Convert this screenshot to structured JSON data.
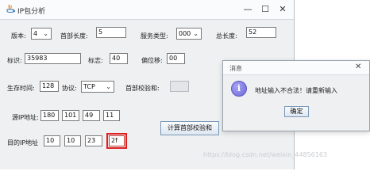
{
  "window": {
    "title": "IP包分析",
    "minimize_glyph": "—",
    "maximize_glyph": "☐",
    "close_glyph": "✕",
    "icon": "java-app-icon"
  },
  "form": {
    "version": {
      "label": "版本:",
      "value": "4"
    },
    "header_length": {
      "label": "首部长度:",
      "value": "5"
    },
    "service_type": {
      "label": "服务类型:",
      "value": "000"
    },
    "total_length": {
      "label": "总长度:",
      "value": "52"
    },
    "identification": {
      "label": "标识:",
      "value": "35983"
    },
    "flags": {
      "label": "标志:",
      "value": "40"
    },
    "fragment_offset": {
      "label": "偏位移:",
      "value": "00"
    },
    "ttl": {
      "label": "生存时间:",
      "value": "128"
    },
    "protocol": {
      "label": "协议:",
      "value": "TCP"
    },
    "header_checksum": {
      "label": "首部校验和:",
      "value": ""
    },
    "source_ip": {
      "label": "源IP地址:",
      "octets": [
        "180",
        "101",
        "49",
        "11"
      ]
    },
    "dest_ip": {
      "label": "目的IP地址",
      "octets": [
        "10",
        "10",
        "23",
        "2f"
      ]
    },
    "compute_button": "计算首部校验和"
  },
  "dialog": {
    "title": "消息",
    "close_glyph": "✕",
    "icon": "info-icon",
    "icon_glyph": "i",
    "message": "地址输入不合法！请重新输入",
    "ok_button": "确定"
  },
  "watermark": "https://blog.csdn.net/weixin_44856163",
  "colors": {
    "window_bg": "#eef0f2",
    "focus_highlight": "#e02020",
    "info_icon": "#6c68d8"
  }
}
